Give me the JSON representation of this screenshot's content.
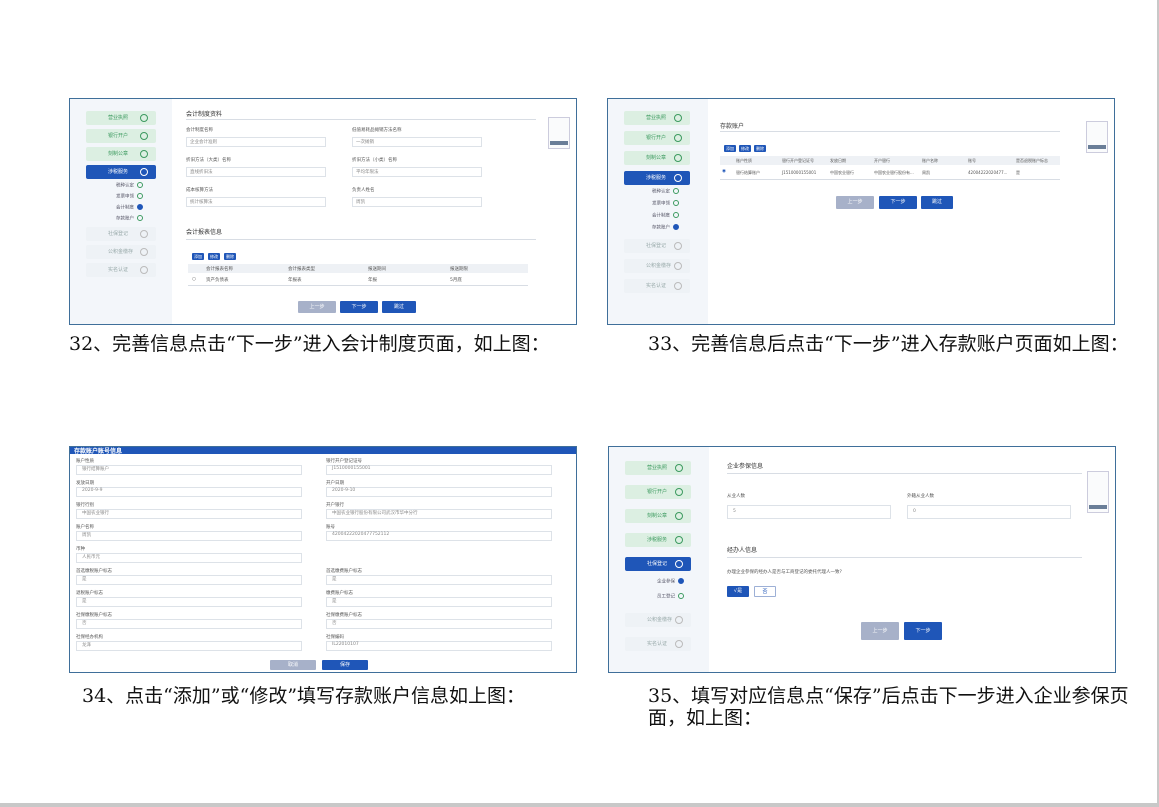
{
  "captions": {
    "c32": "32、完善信息点击“下一步”进入会计制度页面，如上图：",
    "c33": "33、完善信息后点击“下一步”进入存款账户页面如上图：",
    "c34": "34、点击“添加”或“修改”填写存款账户信息如上图：",
    "c35": "35、填写对应信息点“保存”后点击下一步进入企业参保页面，如上图："
  },
  "sidebar": {
    "items": [
      "营业执照",
      "银行开户",
      "刻制公章",
      "涉税服务",
      "社保登记",
      "公积金缴存",
      "实名认证"
    ],
    "sub_tax": [
      "税种认定",
      "发票申领",
      "会计制度",
      "存款账户"
    ],
    "sub_social": [
      "企业参保",
      "员工登记"
    ]
  },
  "shot32": {
    "section1": "会计制度资料",
    "lbl_a": "会计制度名称",
    "val_a": "企业会计准则",
    "lbl_b": "低值易耗品摊销方法名称",
    "val_b": "一次摊销",
    "lbl_c": "折旧方法（大类）名称",
    "val_c": "直线折旧法",
    "lbl_d": "折旧方法（小类）名称",
    "val_d": "平均年限法",
    "lbl_e": "成本核算方法",
    "val_e": "统计核算法",
    "lbl_f": "负责人姓名",
    "val_f": "周凯",
    "section2": "会计报表信息",
    "tb_add": "添加",
    "tb_edit": "修改",
    "tb_del": "删除",
    "cols": [
      "会计报表名称",
      "会计报表类型",
      "报送期间",
      "报送期限"
    ],
    "row": [
      "资产负债表",
      "年报表",
      "年报",
      "5月底"
    ],
    "btn_prev": "上一步",
    "btn_next": "下一步",
    "btn_skip": "跳过"
  },
  "shot33": {
    "title": "存款账户",
    "tb_add": "添加",
    "tb_edit": "修改",
    "tb_del": "删除",
    "cols": [
      "账户性质",
      "银行开户登记证号",
      "发放日期",
      "开户银行",
      "账户名称",
      "账号",
      "是否退税账户标志"
    ],
    "row": [
      "银行结算账户",
      "J1510000155001",
      "中国农业银行",
      "中国农业银行股份有...",
      "周凯",
      "42004222020477...",
      "是"
    ],
    "btn_prev": "上一步",
    "btn_next": "下一步",
    "btn_skip": "跳过"
  },
  "shot34": {
    "title": "存款账户账号信息",
    "fields": [
      {
        "l": "账户性质",
        "v": "银行结算账户",
        "r": "银行开户登记证号",
        "rv": "J1510000155001"
      },
      {
        "l": "发放日期",
        "v": "2020-9-9",
        "r": "开户日期",
        "rv": "2020-9-10"
      },
      {
        "l": "银行行别",
        "v": "中国农业银行",
        "r": "开户银行",
        "rv": "中国农业银行股份有限公司武汉市华中分行"
      },
      {
        "l": "账户名称",
        "v": "周凯",
        "r": "账号",
        "rv": "42004222020477752112"
      },
      {
        "l": "币种",
        "v": "人民币元",
        "r": "",
        "rv": ""
      },
      {
        "l": "首选缴税账户标志",
        "v": "是",
        "r": "首选缴费账户标志",
        "rv": "是"
      },
      {
        "l": "退税账户标志",
        "v": "是",
        "r": "缴费账户标志",
        "rv": "是"
      },
      {
        "l": "社保缴税账户标志",
        "v": "否",
        "r": "社保缴费账户标志",
        "rv": "否"
      },
      {
        "l": "社保经办机构",
        "v": "龙泽",
        "r": "社保编码",
        "rv": "IL22010107"
      }
    ],
    "btn_cancel": "取消",
    "btn_save": "保存"
  },
  "shot35": {
    "section1": "企业参保信息",
    "lbl_a": "从业人数",
    "val_a": "5",
    "lbl_b": "外籍从业人数",
    "val_b": "0",
    "section2": "经办人信息",
    "question": "办理企业参保的经办人是否与工商登记的委托代理人一致?",
    "opt_yes": "√是",
    "opt_no": "否",
    "btn_prev": "上一步",
    "btn_next": "下一步"
  }
}
